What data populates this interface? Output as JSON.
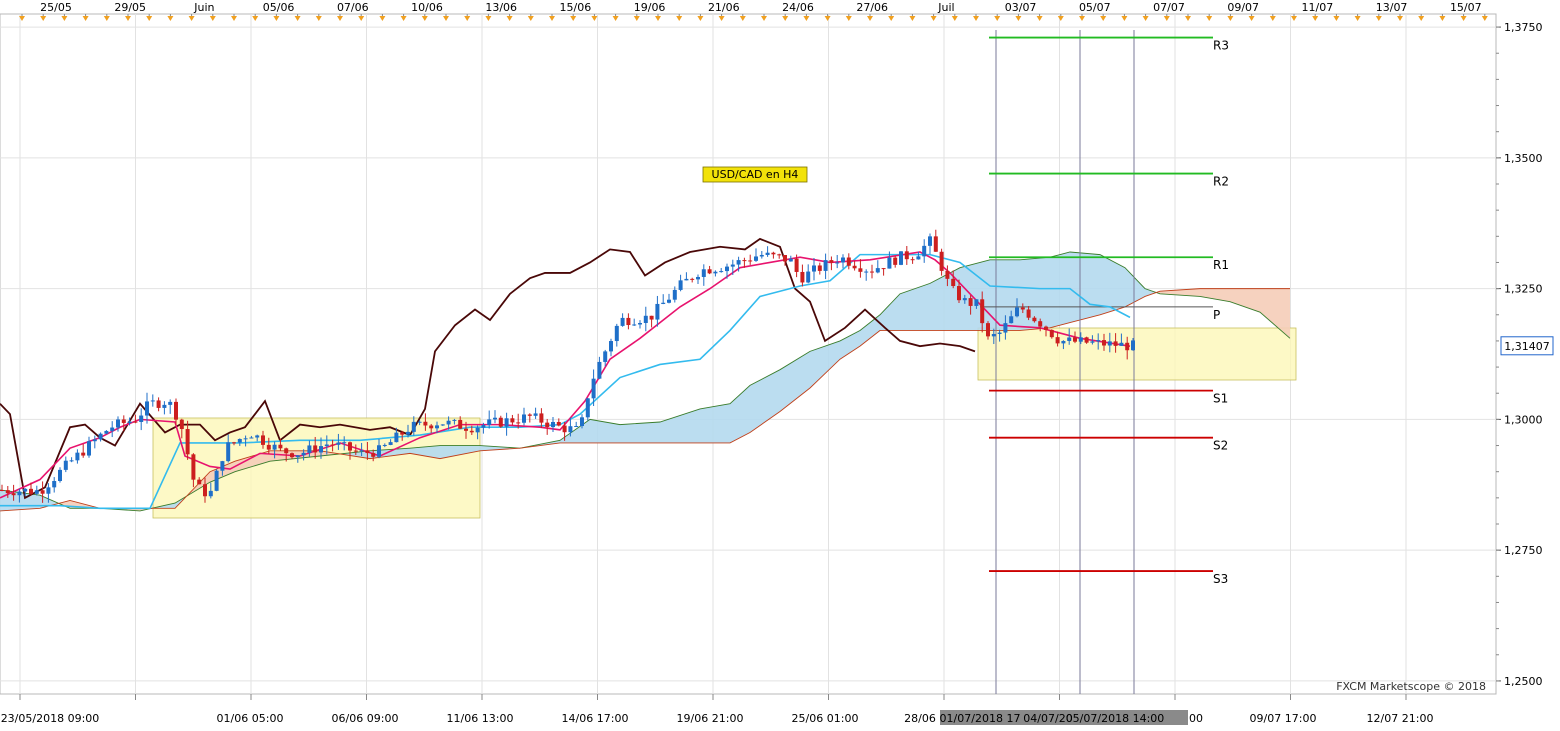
{
  "chart_data": {
    "type": "candlestick",
    "title": "USD/CAD en H4",
    "watermark": "FXCM Marketscope © 2018",
    "ylim": [
      1.2475,
      1.3775
    ],
    "y_ticks": [
      "1,3750",
      "1,3500",
      "1,3250",
      "1,3000",
      "1,2750",
      "1,2500"
    ],
    "y_tick_values": [
      1.375,
      1.35,
      1.325,
      1.3,
      1.275,
      1.25
    ],
    "top_date_labels": [
      "25/05",
      "29/05",
      "Juin",
      "05/06",
      "07/06",
      "10/06",
      "13/06",
      "15/06",
      "19/06",
      "21/06",
      "24/06",
      "27/06",
      "Juil",
      "03/07",
      "05/07",
      "07/07",
      "09/07",
      "11/07",
      "13/07",
      "15/07"
    ],
    "bottom_time_labels": [
      "23/05/2018 09:00",
      "01/06 05:00",
      "06/06 09:00",
      "11/06 13:00",
      "14/06 17:00",
      "19/06 21:00",
      "25/06 01:00",
      "28/06",
      "00",
      "09/07 17:00",
      "12/07 21:00"
    ],
    "bottom_highlight_labels": [
      "01/07/2018 17",
      "04/07/20",
      "05/07/2018 14:00"
    ],
    "current_price_label": "1,31407",
    "current_price": 1.31407,
    "pivot_levels": [
      {
        "label": "R3",
        "value": 1.373,
        "color": "#22bb22"
      },
      {
        "label": "R2",
        "value": 1.347,
        "color": "#22bb22"
      },
      {
        "label": "R1",
        "value": 1.331,
        "color": "#22bb22"
      },
      {
        "label": "P",
        "value": 1.3215,
        "color": "#555555"
      },
      {
        "label": "S1",
        "value": 1.3055,
        "color": "#cc0000"
      },
      {
        "label": "S2",
        "value": 1.2965,
        "color": "#cc0000"
      },
      {
        "label": "S3",
        "value": 1.271,
        "color": "#cc0000"
      }
    ],
    "colors": {
      "bull": "#1f6fc8",
      "bear": "#cc1f1f",
      "tenkan": "#e8136e",
      "kijun": "#33bbee",
      "chikou": "#4a0808",
      "kumo_bull": "#b4d9ee",
      "kumo_bear": "#f5cdb8",
      "box_fill": "#fcf7b8",
      "grid": "#e2e2e2"
    },
    "series": {
      "price_path": [
        [
          0,
          1.2865
        ],
        [
          40,
          1.2863
        ],
        [
          70,
          1.2918
        ],
        [
          110,
          1.2985
        ],
        [
          135,
          1.3
        ],
        [
          150,
          1.303
        ],
        [
          168,
          1.3035
        ],
        [
          180,
          1.2998
        ],
        [
          195,
          1.2872
        ],
        [
          210,
          1.2855
        ],
        [
          225,
          1.2945
        ],
        [
          250,
          1.2975
        ],
        [
          280,
          1.294
        ],
        [
          300,
          1.2935
        ],
        [
          330,
          1.2955
        ],
        [
          360,
          1.2935
        ],
        [
          380,
          1.294
        ],
        [
          410,
          1.2985
        ],
        [
          440,
          1.2995
        ],
        [
          470,
          1.2985
        ],
        [
          500,
          1.2995
        ],
        [
          530,
          1.3005
        ],
        [
          560,
          1.2985
        ],
        [
          580,
          1.2978
        ],
        [
          590,
          1.3065
        ],
        [
          600,
          1.311
        ],
        [
          620,
          1.319
        ],
        [
          650,
          1.3195
        ],
        [
          680,
          1.3255
        ],
        [
          700,
          1.3285
        ],
        [
          730,
          1.3295
        ],
        [
          760,
          1.3315
        ],
        [
          790,
          1.3305
        ],
        [
          800,
          1.327
        ],
        [
          820,
          1.329
        ],
        [
          840,
          1.331
        ],
        [
          870,
          1.3285
        ],
        [
          900,
          1.331
        ],
        [
          915,
          1.3315
        ],
        [
          930,
          1.334
        ],
        [
          940,
          1.33
        ],
        [
          950,
          1.325
        ],
        [
          965,
          1.3225
        ],
        [
          980,
          1.3218
        ],
        [
          985,
          1.315
        ],
        [
          1000,
          1.3165
        ],
        [
          1020,
          1.3215
        ],
        [
          1040,
          1.3185
        ],
        [
          1060,
          1.315
        ],
        [
          1080,
          1.3148
        ],
        [
          1100,
          1.3145
        ],
        [
          1135,
          1.314
        ]
      ],
      "tenkan": [
        [
          0,
          1.285
        ],
        [
          40,
          1.2885
        ],
        [
          70,
          1.2945
        ],
        [
          100,
          1.2965
        ],
        [
          120,
          1.2985
        ],
        [
          140,
          1.3
        ],
        [
          175,
          1.2995
        ],
        [
          185,
          1.293
        ],
        [
          210,
          1.291
        ],
        [
          230,
          1.2905
        ],
        [
          260,
          1.2935
        ],
        [
          300,
          1.293
        ],
        [
          340,
          1.2955
        ],
        [
          380,
          1.293
        ],
        [
          420,
          1.2965
        ],
        [
          460,
          1.299
        ],
        [
          500,
          1.299
        ],
        [
          540,
          1.2985
        ],
        [
          560,
          1.298
        ],
        [
          585,
          1.3035
        ],
        [
          610,
          1.3115
        ],
        [
          640,
          1.3155
        ],
        [
          680,
          1.3215
        ],
        [
          710,
          1.325
        ],
        [
          740,
          1.329
        ],
        [
          770,
          1.33
        ],
        [
          800,
          1.331
        ],
        [
          830,
          1.33
        ],
        [
          870,
          1.3305
        ],
        [
          920,
          1.332
        ],
        [
          935,
          1.3305
        ],
        [
          950,
          1.328
        ],
        [
          970,
          1.324
        ],
        [
          1000,
          1.318
        ],
        [
          1040,
          1.3175
        ],
        [
          1080,
          1.3155
        ],
        [
          1130,
          1.314
        ]
      ],
      "kijun": [
        [
          0,
          1.2835
        ],
        [
          60,
          1.2835
        ],
        [
          100,
          1.283
        ],
        [
          150,
          1.283
        ],
        [
          180,
          1.2955
        ],
        [
          240,
          1.2955
        ],
        [
          300,
          1.296
        ],
        [
          360,
          1.296
        ],
        [
          420,
          1.297
        ],
        [
          470,
          1.2985
        ],
        [
          520,
          1.2985
        ],
        [
          560,
          1.299
        ],
        [
          580,
          1.301
        ],
        [
          620,
          1.308
        ],
        [
          660,
          1.3105
        ],
        [
          700,
          1.3115
        ],
        [
          730,
          1.317
        ],
        [
          760,
          1.3235
        ],
        [
          800,
          1.3255
        ],
        [
          830,
          1.3265
        ],
        [
          860,
          1.3315
        ],
        [
          930,
          1.3315
        ],
        [
          960,
          1.33
        ],
        [
          990,
          1.3255
        ],
        [
          1040,
          1.325
        ],
        [
          1070,
          1.325
        ],
        [
          1090,
          1.322
        ],
        [
          1110,
          1.3215
        ],
        [
          1130,
          1.3195
        ]
      ],
      "chikou": [
        [
          0,
          1.303
        ],
        [
          10,
          1.301
        ],
        [
          25,
          1.285
        ],
        [
          45,
          1.287
        ],
        [
          70,
          1.2985
        ],
        [
          85,
          1.299
        ],
        [
          100,
          1.2965
        ],
        [
          115,
          1.295
        ],
        [
          140,
          1.303
        ],
        [
          165,
          1.2975
        ],
        [
          180,
          1.299
        ],
        [
          200,
          1.299
        ],
        [
          215,
          1.296
        ],
        [
          230,
          1.2975
        ],
        [
          245,
          1.2985
        ],
        [
          265,
          1.3035
        ],
        [
          280,
          1.296
        ],
        [
          300,
          1.299
        ],
        [
          320,
          1.2985
        ],
        [
          340,
          1.299
        ],
        [
          370,
          1.298
        ],
        [
          390,
          1.2985
        ],
        [
          410,
          1.297
        ],
        [
          425,
          1.302
        ],
        [
          435,
          1.313
        ],
        [
          455,
          1.318
        ],
        [
          475,
          1.321
        ],
        [
          490,
          1.319
        ],
        [
          510,
          1.324
        ],
        [
          530,
          1.327
        ],
        [
          545,
          1.328
        ],
        [
          570,
          1.328
        ],
        [
          590,
          1.33
        ],
        [
          610,
          1.3325
        ],
        [
          630,
          1.332
        ],
        [
          645,
          1.3275
        ],
        [
          665,
          1.33
        ],
        [
          690,
          1.332
        ],
        [
          720,
          1.333
        ],
        [
          745,
          1.3325
        ],
        [
          760,
          1.3345
        ],
        [
          780,
          1.333
        ],
        [
          795,
          1.325
        ],
        [
          810,
          1.3225
        ],
        [
          825,
          1.315
        ],
        [
          845,
          1.3175
        ],
        [
          865,
          1.321
        ],
        [
          885,
          1.3175
        ],
        [
          900,
          1.315
        ],
        [
          920,
          1.314
        ],
        [
          940,
          1.3145
        ],
        [
          960,
          1.314
        ],
        [
          975,
          1.313
        ]
      ],
      "senkou_a": [
        [
          0,
          1.2865
        ],
        [
          40,
          1.2855
        ],
        [
          70,
          1.283
        ],
        [
          100,
          1.283
        ],
        [
          140,
          1.2825
        ],
        [
          175,
          1.284
        ],
        [
          210,
          1.288
        ],
        [
          235,
          1.29
        ],
        [
          270,
          1.292
        ],
        [
          320,
          1.293
        ],
        [
          370,
          1.294
        ],
        [
          410,
          1.2945
        ],
        [
          440,
          1.295
        ],
        [
          480,
          1.295
        ],
        [
          520,
          1.2945
        ],
        [
          560,
          1.296
        ],
        [
          590,
          1.3
        ],
        [
          620,
          1.299
        ],
        [
          660,
          1.2995
        ],
        [
          700,
          1.302
        ],
        [
          730,
          1.303
        ],
        [
          750,
          1.3065
        ],
        [
          780,
          1.3095
        ],
        [
          810,
          1.313
        ],
        [
          840,
          1.315
        ],
        [
          860,
          1.317
        ],
        [
          880,
          1.32
        ],
        [
          900,
          1.324
        ],
        [
          930,
          1.326
        ],
        [
          960,
          1.329
        ],
        [
          990,
          1.3305
        ],
        [
          1020,
          1.3305
        ],
        [
          1050,
          1.331
        ],
        [
          1070,
          1.332
        ],
        [
          1100,
          1.3315
        ],
        [
          1125,
          1.329
        ],
        [
          1145,
          1.325
        ],
        [
          1160,
          1.324
        ],
        [
          1200,
          1.3235
        ],
        [
          1230,
          1.3225
        ],
        [
          1260,
          1.3205
        ],
        [
          1290,
          1.3155
        ]
      ],
      "senkou_b": [
        [
          0,
          1.2825
        ],
        [
          40,
          1.283
        ],
        [
          70,
          1.2845
        ],
        [
          100,
          1.283
        ],
        [
          140,
          1.283
        ],
        [
          175,
          1.283
        ],
        [
          210,
          1.29
        ],
        [
          235,
          1.292
        ],
        [
          270,
          1.294
        ],
        [
          320,
          1.294
        ],
        [
          370,
          1.2925
        ],
        [
          410,
          1.2935
        ],
        [
          440,
          1.2925
        ],
        [
          480,
          1.294
        ],
        [
          520,
          1.2945
        ],
        [
          560,
          1.2955
        ],
        [
          590,
          1.2955
        ],
        [
          620,
          1.2955
        ],
        [
          660,
          1.2955
        ],
        [
          700,
          1.2955
        ],
        [
          730,
          1.2955
        ],
        [
          750,
          1.2975
        ],
        [
          780,
          1.3015
        ],
        [
          810,
          1.306
        ],
        [
          840,
          1.3115
        ],
        [
          860,
          1.314
        ],
        [
          880,
          1.317
        ],
        [
          900,
          1.317
        ],
        [
          930,
          1.317
        ],
        [
          960,
          1.317
        ],
        [
          990,
          1.317
        ],
        [
          1020,
          1.317
        ],
        [
          1050,
          1.3175
        ],
        [
          1070,
          1.3185
        ],
        [
          1100,
          1.32
        ],
        [
          1125,
          1.3215
        ],
        [
          1145,
          1.3235
        ],
        [
          1160,
          1.3245
        ],
        [
          1200,
          1.325
        ],
        [
          1230,
          1.325
        ],
        [
          1260,
          1.325
        ],
        [
          1290,
          1.325
        ]
      ]
    }
  }
}
